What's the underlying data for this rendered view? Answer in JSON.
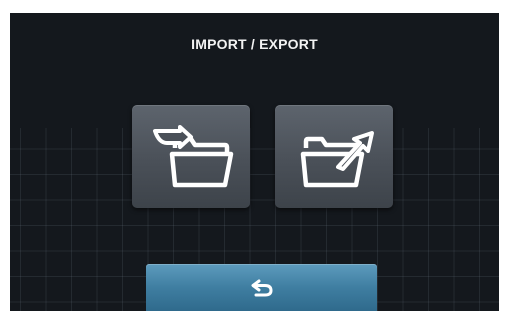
{
  "screen": {
    "title": "IMPORT / EXPORT"
  },
  "buttons": [
    {
      "id": "import",
      "icon": "folder-import-icon"
    },
    {
      "id": "export",
      "icon": "folder-export-icon"
    }
  ],
  "back_button": {
    "icon": "return-arrow-icon"
  },
  "colors": {
    "background": "#14181d",
    "title_text": "#f2f2f2",
    "action_button": "#4a5058",
    "back_button": "#3f7ea1",
    "icon_stroke": "#ffffff"
  }
}
